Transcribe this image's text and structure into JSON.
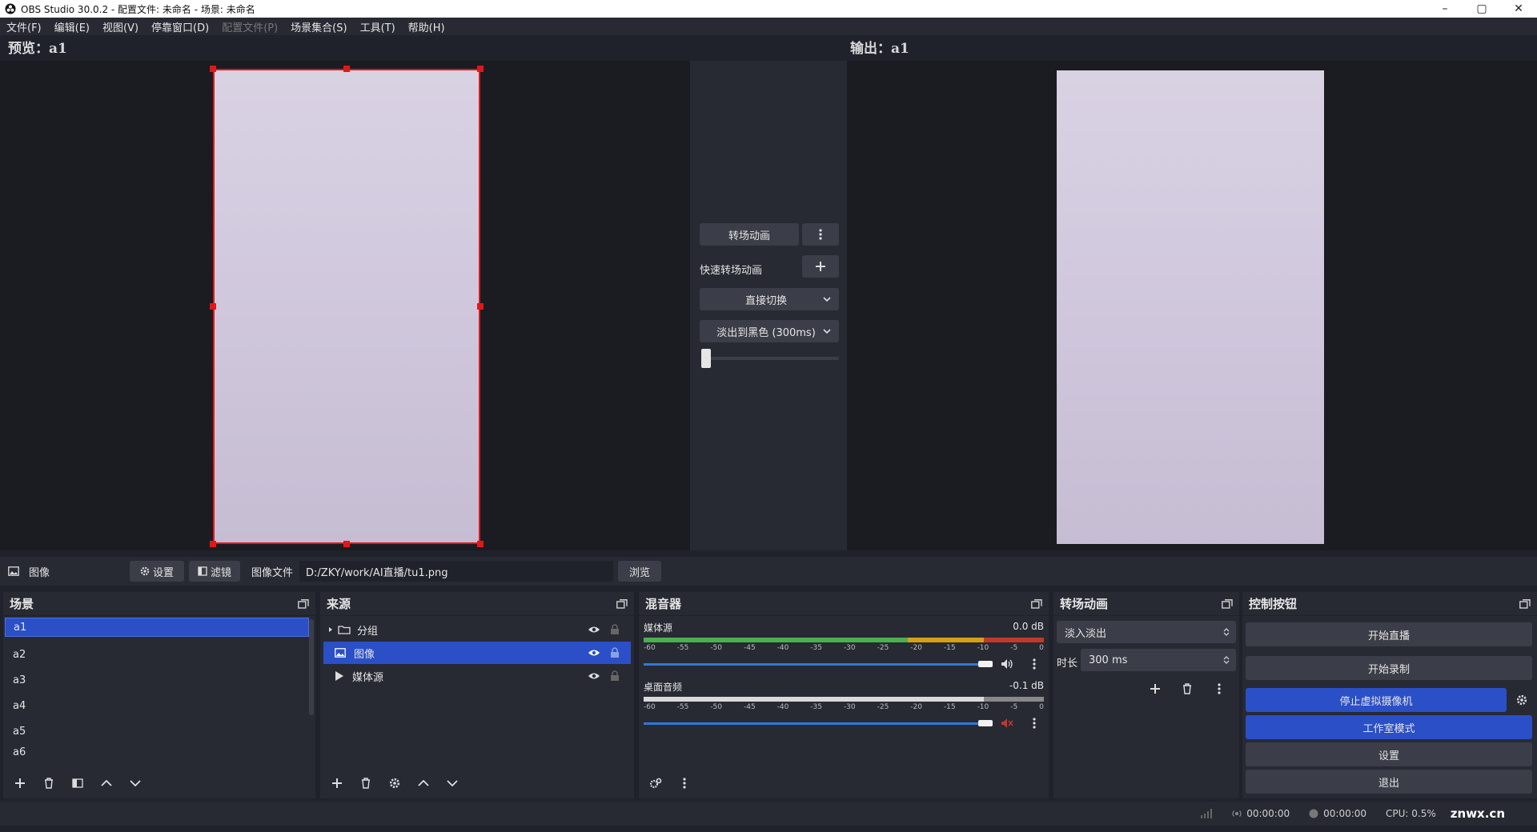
{
  "window": {
    "title": "OBS Studio 30.0.2 - 配置文件: 未命名 - 场景: 未命名",
    "min": "–",
    "max": "▢",
    "close": "✕"
  },
  "menu": [
    {
      "label": "文件(F)",
      "disabled": false
    },
    {
      "label": "编辑(E)",
      "disabled": false
    },
    {
      "label": "视图(V)",
      "disabled": false
    },
    {
      "label": "停靠窗口(D)",
      "disabled": false
    },
    {
      "label": "配置文件(P)",
      "disabled": true
    },
    {
      "label": "场景集合(S)",
      "disabled": false
    },
    {
      "label": "工具(T)",
      "disabled": false
    },
    {
      "label": "帮助(H)",
      "disabled": false
    }
  ],
  "preview": {
    "label": "预览：a1"
  },
  "program": {
    "label": "输出：a1"
  },
  "transition_controls": {
    "transition_button": "转场动画",
    "quick_transitions": "快速转场动画",
    "cut_option": "直接切换",
    "fade_option": "淡出到黑色 (300ms)"
  },
  "properties_bar": {
    "source_name": "图像",
    "settings": "设置",
    "filters": "滤镜",
    "file_label": "图像文件",
    "file_path": "D:/ZKY/work/AI直播/tu1.png",
    "browse": "浏览"
  },
  "scenes": {
    "title": "场景",
    "items": [
      "a1",
      "a2",
      "a3",
      "a4",
      "a5",
      "a6"
    ],
    "selected": 0
  },
  "sources": {
    "title": "来源",
    "items": [
      {
        "label": "分组",
        "icon": "folder-icon"
      },
      {
        "label": "图像",
        "icon": "image-icon"
      },
      {
        "label": "媒体源",
        "icon": "play-icon"
      }
    ],
    "selected": 1
  },
  "mixer": {
    "title": "混音器",
    "channels": [
      {
        "name": "媒体源",
        "db": "0.0 dB",
        "level": 0.99,
        "muted": false
      },
      {
        "name": "桌面音频",
        "db": "-0.1 dB",
        "level": 0.99,
        "muted": true
      }
    ],
    "scale": [
      "-60",
      "-55",
      "-50",
      "-45",
      "-40",
      "-35",
      "-30",
      "-25",
      "-20",
      "-15",
      "-10",
      "-5",
      "0"
    ]
  },
  "transitions": {
    "title": "转场动画",
    "selected": "淡入淡出",
    "duration_label": "时长",
    "duration": "300 ms"
  },
  "controls": {
    "title": "控制按钮",
    "start_stream": "开始直播",
    "start_record": "开始录制",
    "stop_vcam": "停止虚拟摄像机",
    "studio_mode": "工作室模式",
    "settings": "设置",
    "exit": "退出"
  },
  "status": {
    "stream_time": "00:00:00",
    "record_time": "00:00:00",
    "cpu": "CPU: 0.5%",
    "watermark": "znwx.cn"
  },
  "colors": {
    "accent": "#2a4fc7",
    "selection": "#e01818",
    "meter_green": "#4caf50",
    "meter_yellow": "#d4a017",
    "meter_red": "#c0392b"
  }
}
